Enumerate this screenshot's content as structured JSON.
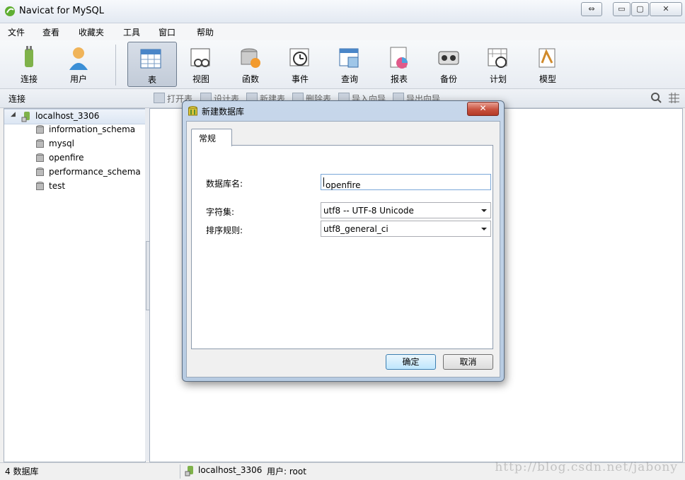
{
  "window": {
    "title": "Navicat for MySQL",
    "restore_icon": "⇔",
    "min_icon": "▭",
    "max_icon": "▢",
    "close_icon": "✕"
  },
  "menu": [
    "文件",
    "查看",
    "收藏夹",
    "工具",
    "窗口",
    "帮助"
  ],
  "toolbar": {
    "connect": "连接",
    "user": "用户",
    "table": "表",
    "view": "视图",
    "function": "函数",
    "event": "事件",
    "query": "查询",
    "report": "报表",
    "backup": "备份",
    "schedule": "计划",
    "model": "模型"
  },
  "subbar": {
    "connection_label": "连接",
    "actions": [
      "打开表",
      "设计表",
      "新建表",
      "删除表",
      "导入向导",
      "导出向导"
    ]
  },
  "tree": {
    "root": "localhost_3306",
    "databases": [
      "information_schema",
      "mysql",
      "openfire",
      "performance_schema",
      "test"
    ]
  },
  "status": {
    "count": "4 数据库",
    "connection": "localhost_3306",
    "user": "用户: root",
    "watermark": "http://blog.csdn.net/jabony"
  },
  "dialog": {
    "title": "新建数据库",
    "tab": "常规",
    "dbname_label": "数据库名:",
    "dbname_value": "openfire",
    "charset_label": "字符集:",
    "charset_value": "utf8 -- UTF-8 Unicode",
    "collation_label": "排序规则:",
    "collation_value": "utf8_general_ci",
    "ok": "确定",
    "cancel": "取消"
  }
}
